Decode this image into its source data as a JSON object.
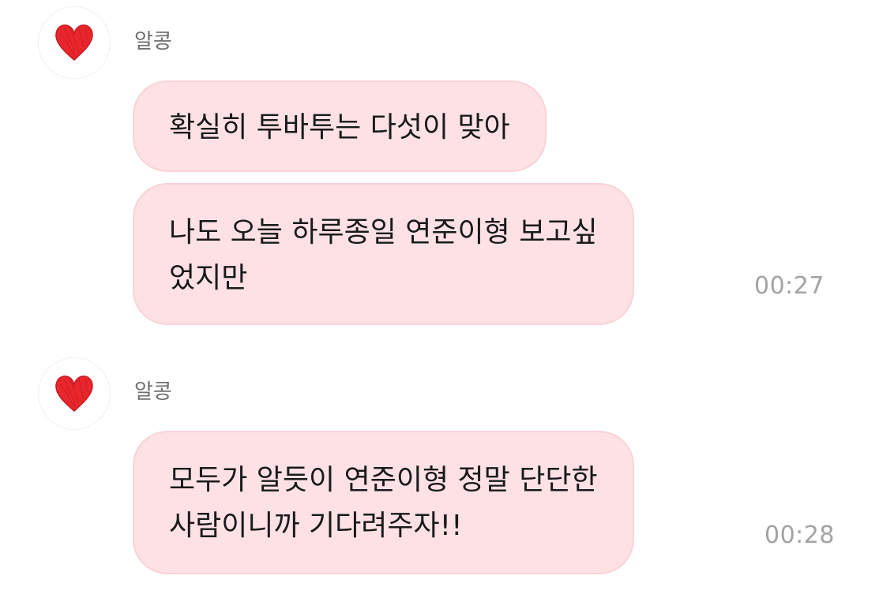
{
  "conversation": {
    "groups": [
      {
        "sender": "알콩",
        "messages": [
          {
            "lines": [
              "확실히 투바투는 다섯이 맞아"
            ]
          },
          {
            "lines": [
              "나도 오늘 하루종일 연준이형 보고싶",
              "었지만"
            ],
            "time": "00:27"
          }
        ]
      },
      {
        "sender": "알콩",
        "messages": [
          {
            "lines": [
              "모두가 알듯이 연준이형 정말 단단한",
              "사람이니까 기다려주자!!"
            ],
            "time": "00:28"
          }
        ]
      }
    ]
  },
  "icons": {
    "avatar": "red-heart-icon"
  },
  "colors": {
    "bubble": "#fde1e4",
    "bubble_border": "#f9d3d8",
    "heart": "#e8262c",
    "name_text": "#6f6f6f",
    "time_text": "#a3a3a3"
  }
}
